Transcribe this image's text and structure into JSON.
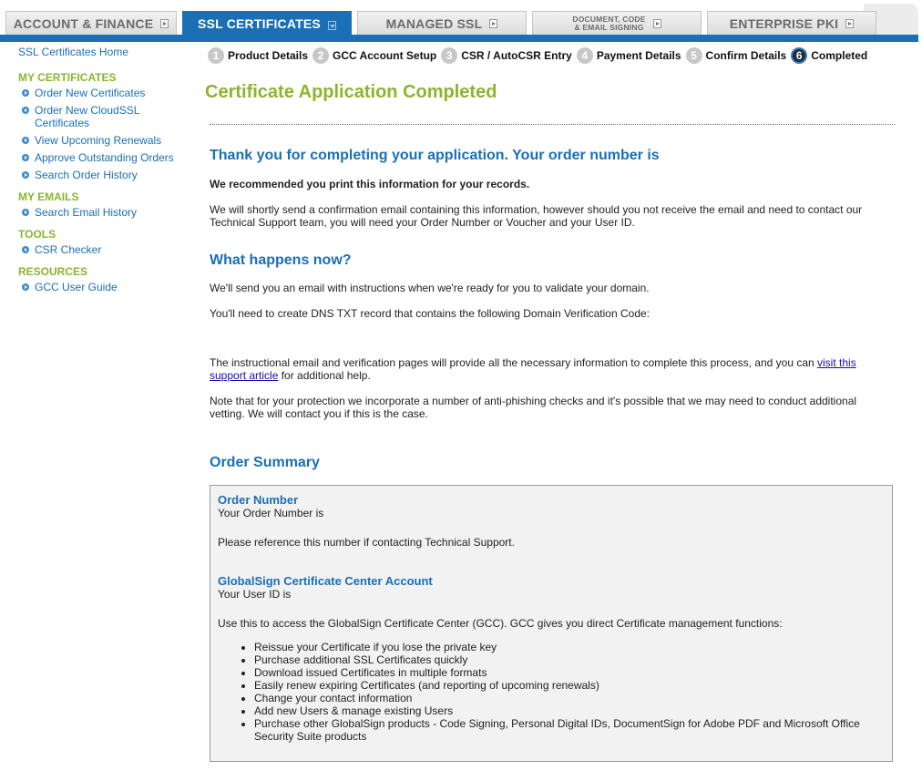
{
  "tabs": [
    {
      "label": "ACCOUNT & FINANCE"
    },
    {
      "label": "SSL CERTIFICATES"
    },
    {
      "label": "MANAGED SSL"
    },
    {
      "line1": "DOCUMENT, CODE",
      "line2": "& EMAIL SIGNING"
    },
    {
      "label": "ENTERPRISE PKI"
    }
  ],
  "sidebar": {
    "home": "SSL Certificates Home",
    "sections": [
      {
        "title": "MY CERTIFICATES",
        "items": [
          "Order New Certificates",
          "Order New CloudSSL Certificates",
          "View Upcoming Renewals",
          "Approve Outstanding Orders",
          "Search Order History"
        ]
      },
      {
        "title": "MY EMAILS",
        "items": [
          "Search Email History"
        ]
      },
      {
        "title": "TOOLS",
        "items": [
          "CSR Checker"
        ]
      },
      {
        "title": "RESOURCES",
        "items": [
          "GCC User Guide"
        ]
      }
    ]
  },
  "steps": [
    {
      "num": "1",
      "label": "Product Details"
    },
    {
      "num": "2",
      "label": "GCC Account Setup"
    },
    {
      "num": "3",
      "label": "CSR / AutoCSR Entry"
    },
    {
      "num": "4",
      "label": "Payment Details"
    },
    {
      "num": "5",
      "label": "Confirm Details"
    },
    {
      "num": "6",
      "label": "Completed"
    }
  ],
  "main": {
    "title": "Certificate Application Completed",
    "thank_you_heading": "Thank you for completing your application. Your order number is",
    "print_notice": "We recommended you print this information for your records.",
    "confirm_email_text": "We will shortly send a confirmation email containing this information, however should you not receive the email and need to contact our Technical Support team, you will need your Order Number or Voucher and your User ID.",
    "what_next_heading": "What happens now?",
    "send_email_text": "We'll send you an email with instructions when we're ready for you to validate your domain.",
    "dns_text": "You'll need to create DNS TXT record that contains the following Domain Verification Code:",
    "instructional_text_before": "The instructional email and verification pages will provide all the necessary information to complete this process, and you can ",
    "support_link": "visit this support article",
    "instructional_text_after": " for additional help.",
    "phishing_text": "Note that for your protection we incorporate a number of anti-phishing checks and it's possible that we may need to conduct additional vetting. We will contact you if this is the case.",
    "order_summary_heading": "Order Summary"
  },
  "summary": {
    "order_number_heading": "Order Number",
    "order_number_text": "Your Order Number is",
    "reference_text": "Please reference this number if contacting Technical Support.",
    "account_heading": "GlobalSign Certificate Center Account",
    "user_id_text": "Your User ID is",
    "gcc_text": "Use this to access the GlobalSign Certificate Center (GCC). GCC gives you direct Certificate management functions:",
    "functions": [
      "Reissue your Certificate if you lose the private key",
      "Purchase additional SSL Certificates quickly",
      "Download issued Certificates in multiple formats",
      "Easily renew expiring Certificates (and reporting of upcoming renewals)",
      "Change your contact information",
      "Add new Users & manage existing Users",
      "Purchase other GlobalSign products - Code Signing, Personal Digital IDs, DocumentSign for Adobe PDF and Microsoft Office Security Suite products"
    ]
  },
  "colors": {
    "brand_blue": "#1a6fb5",
    "accent_green": "#8cb42c"
  }
}
